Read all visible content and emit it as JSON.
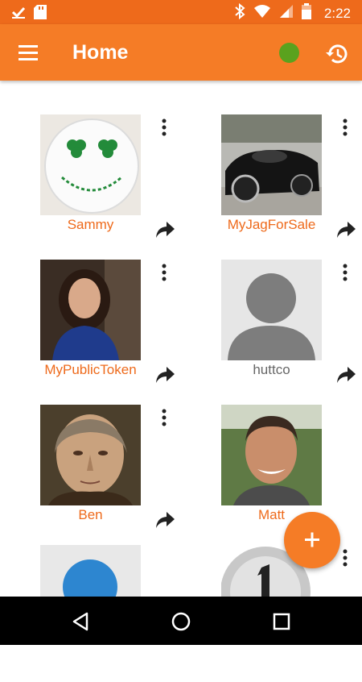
{
  "status_bar": {
    "time": "2:22"
  },
  "app_bar": {
    "title": "Home",
    "status_color": "#5aa21e"
  },
  "tokens": [
    {
      "label": "Sammy",
      "image": "shamrock-smiley-button"
    },
    {
      "label": "MyJagForSale",
      "image": "black-jaguar-car"
    },
    {
      "label": "MyPublicToken",
      "image": "woman-portrait"
    },
    {
      "label": "huttco",
      "image": "default-avatar"
    },
    {
      "label": "Ben",
      "image": "benjamin-franklin-portrait"
    },
    {
      "label": "Matt",
      "image": "man-portrait"
    },
    {
      "label": "",
      "image": "blue-circle"
    },
    {
      "label": "",
      "image": "silver-coin-number-1"
    }
  ],
  "colors": {
    "status_bar": "#ee6a1b",
    "app_bar": "#f57c26",
    "accent": "#f57c26",
    "label": "#ee6a1b"
  },
  "icons": [
    "menu-icon",
    "history-icon",
    "more-vert-icon",
    "share-icon",
    "add-icon",
    "back-icon",
    "home-icon",
    "recents-icon"
  ]
}
